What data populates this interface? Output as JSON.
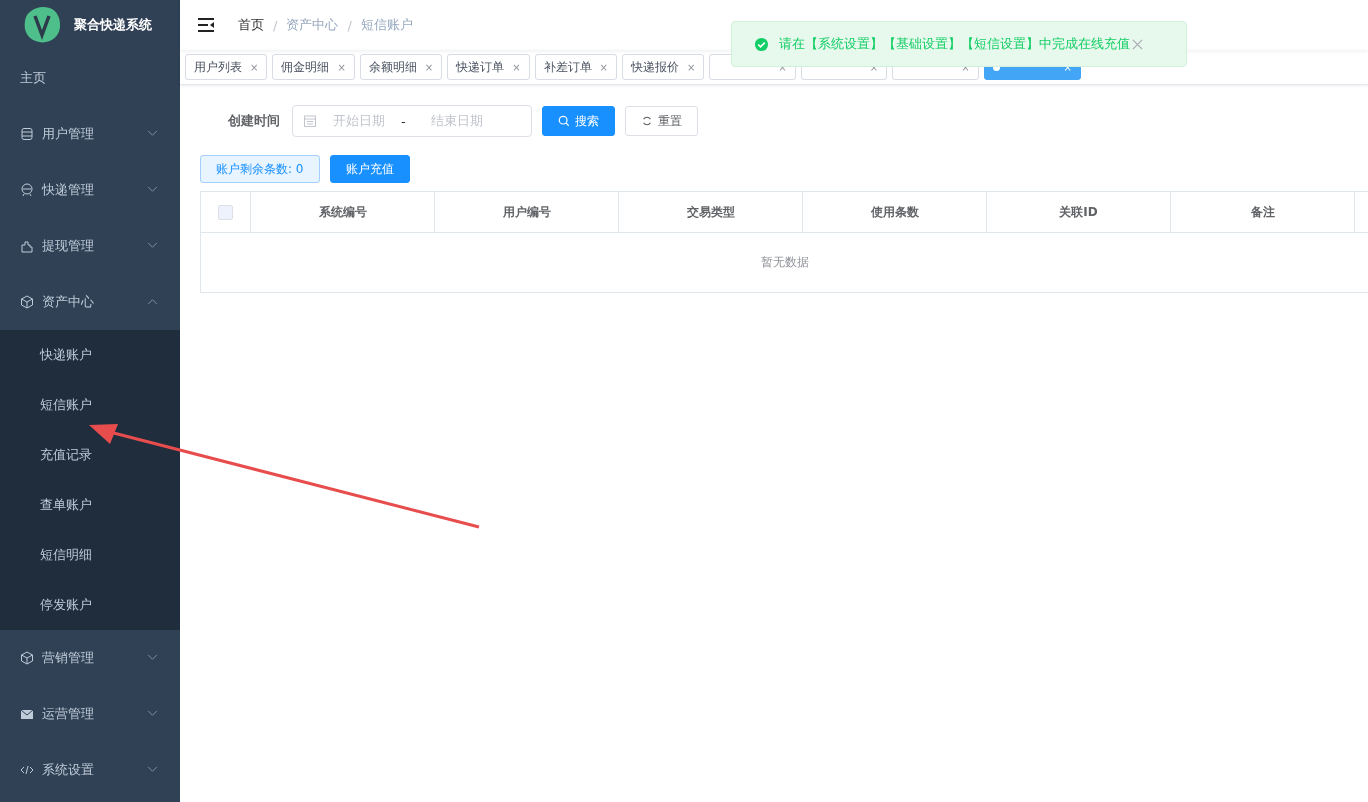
{
  "app": {
    "title": "聚合快递系统"
  },
  "sidebar": {
    "items": [
      {
        "label": "主页"
      },
      {
        "label": "用户管理",
        "expanded": false
      },
      {
        "label": "快递管理",
        "expanded": false
      },
      {
        "label": "提现管理",
        "expanded": false
      },
      {
        "label": "资产中心",
        "expanded": true,
        "children": [
          {
            "label": "快递账户"
          },
          {
            "label": "短信账户"
          },
          {
            "label": "充值记录"
          },
          {
            "label": "查单账户"
          },
          {
            "label": "短信明细"
          },
          {
            "label": "停发账户"
          }
        ]
      },
      {
        "label": "营销管理",
        "expanded": false
      },
      {
        "label": "运营管理",
        "expanded": false
      },
      {
        "label": "系统设置",
        "expanded": false
      }
    ]
  },
  "breadcrumb": [
    {
      "label": "首页"
    },
    {
      "separator": "/",
      "label": "资产中心"
    },
    {
      "separator": "/",
      "label": "短信账户"
    }
  ],
  "tags": [
    {
      "label": "用户列表",
      "close": "×",
      "selected": false
    },
    {
      "label": "佣金明细",
      "close": "×",
      "selected": false
    },
    {
      "label": "余额明细",
      "close": "×",
      "selected": false
    },
    {
      "label": "快递订单",
      "close": "×",
      "selected": false
    },
    {
      "label": "补差订单",
      "close": "×",
      "selected": false
    },
    {
      "label": "快递报价",
      "close": "×",
      "selected": false
    },
    {
      "close": "×",
      "selected": false
    },
    {
      "close": "×",
      "selected": false
    },
    {
      "close": "×",
      "selected": false
    },
    {
      "close": "×",
      "selected": true
    }
  ],
  "toast": {
    "message": "请在【系统设置】【基础设置】【短信设置】中完成在线充值"
  },
  "filter": {
    "label": "创建时间",
    "start_placeholder": "开始日期",
    "separator": "-",
    "end_placeholder": "结束日期",
    "search": "搜索",
    "reset": "重置"
  },
  "balance": "账户剩余条数: 0",
  "recharge": "账户充值",
  "table": {
    "select_all": {
      "checked": false
    },
    "columns": [
      "系统编号",
      "用户编号",
      "交易类型",
      "使用条数",
      "关联ID",
      "备注"
    ],
    "empty": "暂无数据"
  }
}
